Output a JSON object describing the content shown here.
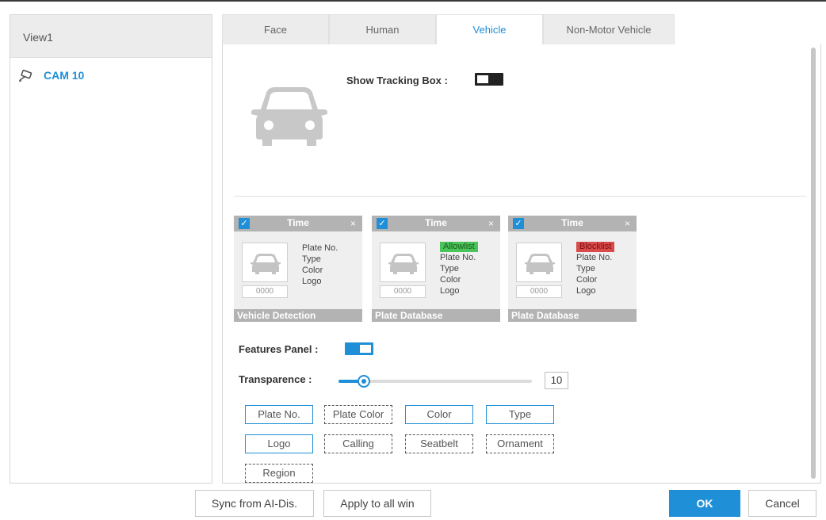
{
  "left_panel": {
    "view_title": "View1",
    "camera": "CAM 10"
  },
  "tabs": [
    {
      "label": "Face",
      "active": false
    },
    {
      "label": "Human",
      "active": false
    },
    {
      "label": "Vehicle",
      "active": true
    },
    {
      "label": "Non-Motor Vehicle",
      "active": false
    }
  ],
  "show_tracking_box": {
    "label": "Show Tracking Box :",
    "enabled": false
  },
  "cards": [
    {
      "header": "Time",
      "lines": [
        "Plate No.",
        "Type",
        "Color",
        "Logo"
      ],
      "plate": "0000",
      "footer": "Vehicle Detection"
    },
    {
      "header": "Time",
      "badge": "Allowlist",
      "lines": [
        "Plate No.",
        "Type",
        "Color",
        "Logo"
      ],
      "plate": "0000",
      "footer": "Plate Database"
    },
    {
      "header": "Time",
      "badge": "Blocklist",
      "lines": [
        "Plate No.",
        "Type",
        "Color",
        "Logo"
      ],
      "plate": "0000",
      "footer": "Plate Database"
    }
  ],
  "features_panel": {
    "label": "Features Panel :",
    "enabled": true
  },
  "transparence": {
    "label": "Transparence :",
    "value": "10",
    "fraction": 0.13
  },
  "feature_buttons": [
    {
      "label": "Plate No.",
      "selected": true
    },
    {
      "label": "Plate Color",
      "selected": false
    },
    {
      "label": "Color",
      "selected": true
    },
    {
      "label": "Type",
      "selected": true
    },
    {
      "label": "Logo",
      "selected": true
    },
    {
      "label": "Calling",
      "selected": false
    },
    {
      "label": "Seatbelt",
      "selected": false
    },
    {
      "label": "Ornament",
      "selected": false
    },
    {
      "label": "Region",
      "selected": false
    }
  ],
  "footer_buttons": {
    "sync": "Sync from AI-Dis.",
    "apply_all": "Apply to all win",
    "ok": "OK",
    "cancel": "Cancel"
  },
  "colors": {
    "accent": "#1f8fd8",
    "allowlist": "#48c45a",
    "blocklist": "#d94a4a"
  },
  "icons": {
    "camera": "camera-icon",
    "vehicle": "car-icon"
  }
}
